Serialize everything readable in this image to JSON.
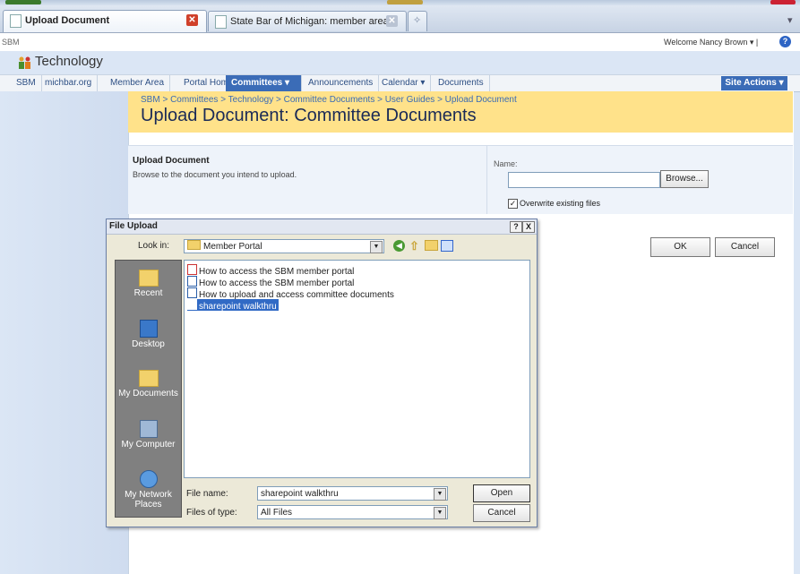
{
  "browser": {
    "tabs": [
      {
        "label": "Upload Document",
        "active": true
      },
      {
        "label": "State Bar of Michigan: member area",
        "active": false
      }
    ]
  },
  "site": {
    "top_left": "SBM",
    "welcome": "Welcome Nancy Brown",
    "site_title": "Technology",
    "nav": [
      "SBM",
      "michbar.org",
      "Member Area",
      "Portal Home",
      "Committees",
      "Announcements",
      "Calendar",
      "Documents"
    ],
    "site_actions": "Site Actions"
  },
  "page": {
    "breadcrumb": "SBM > Committees > Technology > Committee Documents > User Guides > Upload Document",
    "title": "Upload Document: Committee Documents",
    "section_title": "Upload Document",
    "section_desc": "Browse to the document you intend to upload.",
    "name_label": "Name:",
    "browse_label": "Browse...",
    "overwrite_label": "Overwrite existing files",
    "overwrite_checked": true,
    "ok_label": "OK",
    "cancel_label": "Cancel"
  },
  "dialog": {
    "title": "File Upload",
    "help": "?",
    "close": "X",
    "look_in_label": "Look in:",
    "look_in_value": "Member Portal",
    "places": [
      "Recent",
      "Desktop",
      "My Documents",
      "My Computer",
      "My Network Places"
    ],
    "files": [
      {
        "name": "How to access the SBM member portal",
        "icon": "pdf-icon",
        "selected": false
      },
      {
        "name": "How to access the SBM member portal",
        "icon": "word-doc-icon",
        "selected": false
      },
      {
        "name": "How to upload and access committee documents",
        "icon": "word-doc-icon",
        "selected": false
      },
      {
        "name": "sharepoint walkthru",
        "icon": "word-doc-icon",
        "selected": true
      }
    ],
    "file_name_label": "File name:",
    "file_name_value": "sharepoint walkthru",
    "file_type_label": "Files of type:",
    "file_type_value": "All Files",
    "open_label": "Open",
    "cancel_label": "Cancel"
  }
}
